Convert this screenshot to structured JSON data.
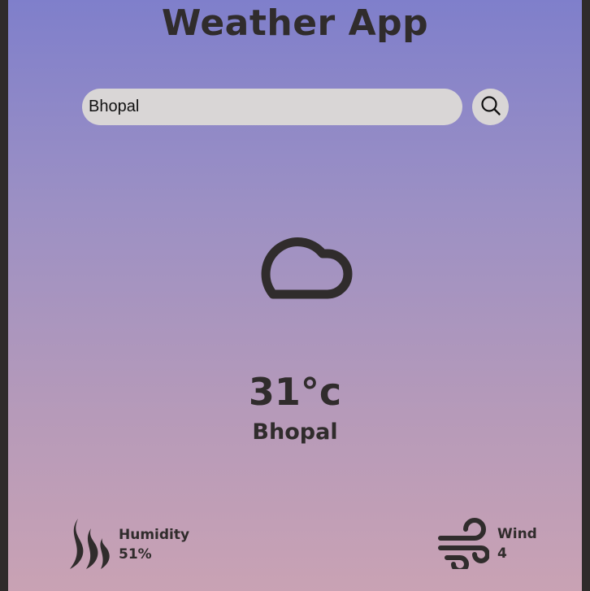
{
  "app": {
    "title": "Weather App"
  },
  "search": {
    "value": "Bhopal",
    "button_icon": "search-icon"
  },
  "weather": {
    "icon": "cloud-icon",
    "temperature": "31°c",
    "city": "Bhopal"
  },
  "details": {
    "humidity": {
      "icon": "humidity-icon",
      "label": "Humidity",
      "value": "51%"
    },
    "wind": {
      "icon": "wind-icon",
      "label": "Wind",
      "value": "4"
    }
  },
  "colors": {
    "gradient_top": "#7f7fcb",
    "gradient_bottom": "#c9a2b4",
    "text": "#302c2c",
    "input_bg": "#d9d6d6",
    "frame": "#2f2b2b"
  }
}
